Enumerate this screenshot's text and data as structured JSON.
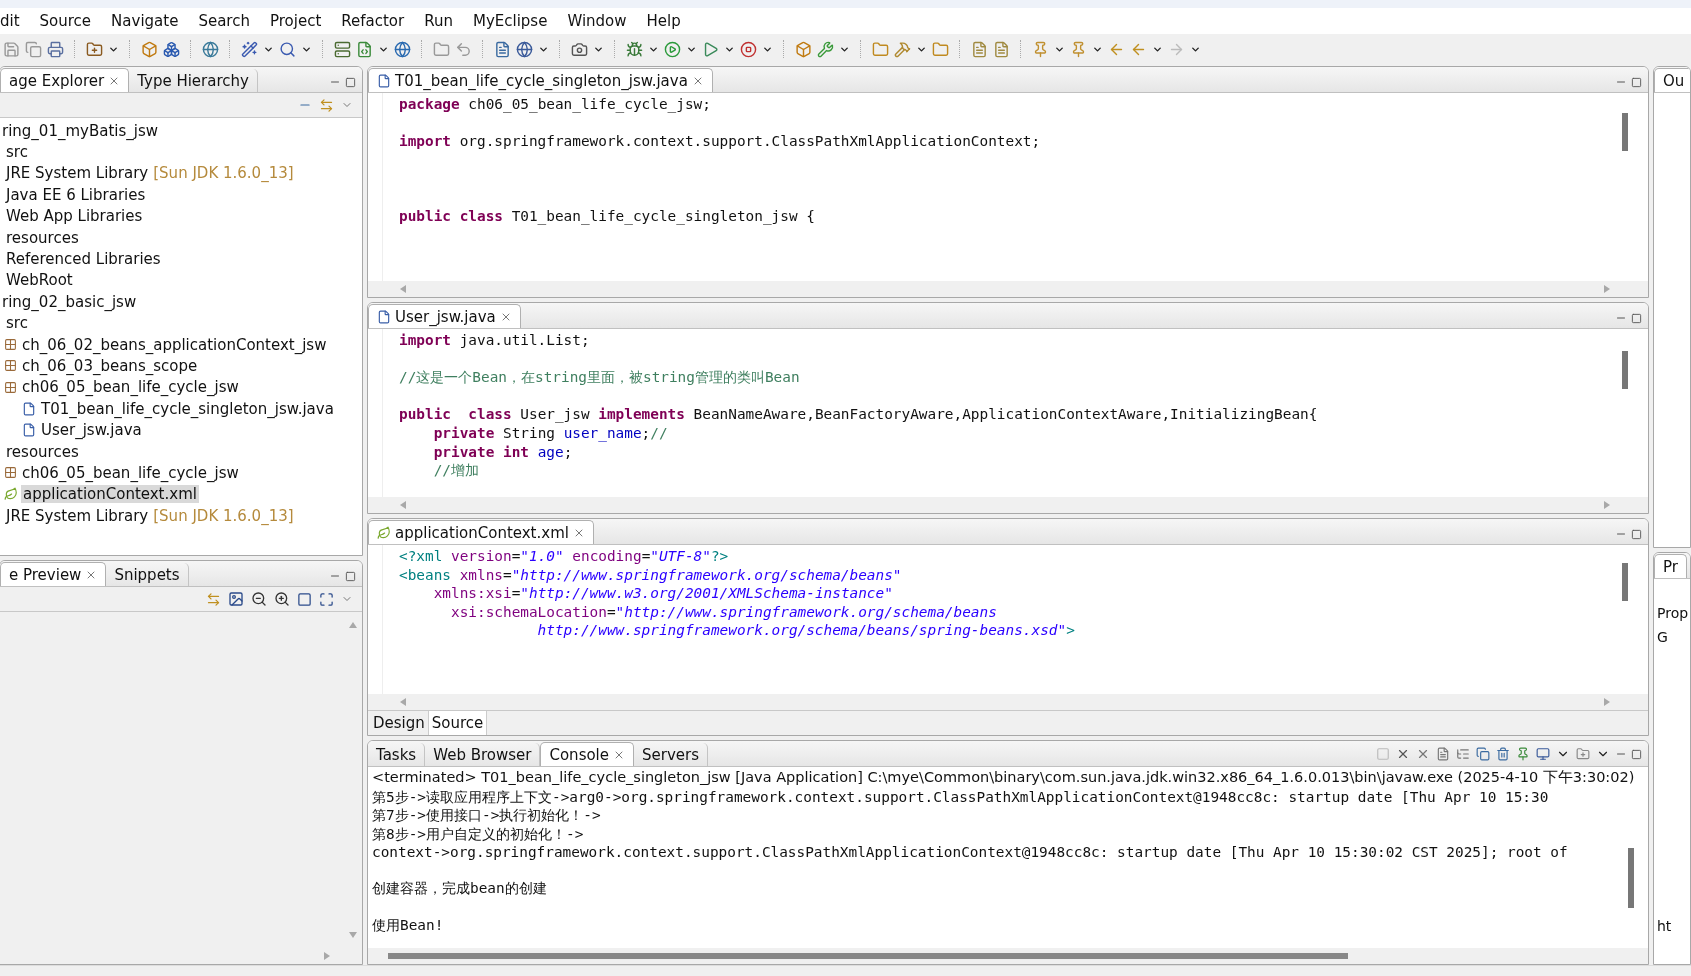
{
  "menu_bar": [
    "dit",
    "Source",
    "Navigate",
    "Search",
    "Project",
    "Refactor",
    "Run",
    "MyEclipse",
    "Window",
    "Help"
  ],
  "package_explorer": {
    "tabs": [
      {
        "label": "age Explorer",
        "selected": true
      },
      {
        "label": "Type Hierarchy",
        "selected": false
      }
    ],
    "tree": [
      {
        "label": "ring_01_myBatis_jsw",
        "selected": false,
        "children": [
          {
            "label": "src",
            "selected": false
          },
          {
            "label": "JRE System Library",
            "decoration": "[Sun JDK 1.6.0_13]",
            "selected": false
          },
          {
            "label": "Java EE 6 Libraries",
            "selected": false
          },
          {
            "label": "Web App Libraries",
            "selected": false
          },
          {
            "label": "resources",
            "selected": false
          },
          {
            "label": "Referenced Libraries",
            "selected": false
          },
          {
            "label": "WebRoot",
            "selected": false
          }
        ]
      },
      {
        "label": "ring_02_basic_jsw",
        "selected": false,
        "children": [
          {
            "label": "src",
            "selected": false,
            "children": [
              {
                "label": "ch_06_02_beans_applicationContext_jsw",
                "kind": "package",
                "selected": false
              },
              {
                "label": "ch_06_03_beans_scope",
                "kind": "package",
                "selected": false
              },
              {
                "label": "ch06_05_bean_life_cycle_jsw",
                "kind": "package",
                "selected": false,
                "children": [
                  {
                    "label": "T01_bean_life_cycle_singleton_jsw.java",
                    "kind": "java",
                    "selected": false
                  },
                  {
                    "label": "User_jsw.java",
                    "kind": "java",
                    "selected": false
                  }
                ]
              }
            ]
          },
          {
            "label": "resources",
            "selected": false,
            "children": [
              {
                "label": "ch06_05_bean_life_cycle_jsw",
                "kind": "package",
                "selected": false
              },
              {
                "label": "applicationContext.xml",
                "kind": "xml",
                "selected": true
              }
            ]
          },
          {
            "label": "JRE System Library",
            "decoration": "[Sun JDK 1.6.0_13]",
            "selected": false
          }
        ]
      }
    ]
  },
  "preview_panel": {
    "tabs": [
      {
        "label": "e Preview",
        "selected": true
      },
      {
        "label": "Snippets",
        "selected": false
      }
    ]
  },
  "editors": [
    {
      "tab": {
        "label": "T01_bean_life_cycle_singleton_jsw.java",
        "kind": "java",
        "selected": true
      },
      "lines": [
        {
          "kind": "code",
          "segments": [
            {
              "kind": "keyword",
              "text": "package"
            },
            {
              "kind": "plain",
              "text": " ch06_05_bean_life_cycle_jsw;"
            }
          ]
        },
        {
          "kind": "blank"
        },
        {
          "kind": "code",
          "segments": [
            {
              "kind": "keyword",
              "text": "import"
            },
            {
              "kind": "plain",
              "text": " org.springframework.context.support.ClassPathXmlApplicationContext;"
            }
          ]
        },
        {
          "kind": "blank"
        },
        {
          "kind": "blank"
        },
        {
          "kind": "blank"
        },
        {
          "kind": "code",
          "segments": [
            {
              "kind": "keyword",
              "text": "public class"
            },
            {
              "kind": "plain",
              "text": " T01_bean_life_cycle_singleton_jsw {"
            }
          ]
        }
      ]
    },
    {
      "tab": {
        "label": "User_jsw.java",
        "kind": "java",
        "selected": true
      },
      "lines": [
        {
          "kind": "code",
          "segments": [
            {
              "kind": "keyword",
              "text": "import"
            },
            {
              "kind": "plain",
              "text": " java.util.List;"
            }
          ]
        },
        {
          "kind": "blank"
        },
        {
          "kind": "code",
          "segments": [
            {
              "kind": "comment",
              "text": "//这是一个Bean，在string里面，被string管理的类叫Bean"
            }
          ]
        },
        {
          "kind": "blank"
        },
        {
          "kind": "code",
          "segments": [
            {
              "kind": "keyword",
              "text": "public  class"
            },
            {
              "kind": "plain",
              "text": " User_jsw "
            },
            {
              "kind": "keyword",
              "text": "implements"
            },
            {
              "kind": "plain",
              "text": " BeanNameAware,BeanFactoryAware,ApplicationContextAware,InitializingBean{"
            }
          ]
        },
        {
          "kind": "code",
          "segments": [
            {
              "kind": "keyword",
              "text": "    private"
            },
            {
              "kind": "plain",
              "text": " String "
            },
            {
              "kind": "field",
              "text": "user_name"
            },
            {
              "kind": "plain",
              "text": ";"
            },
            {
              "kind": "comment",
              "text": "//"
            }
          ]
        },
        {
          "kind": "code",
          "segments": [
            {
              "kind": "keyword",
              "text": "    private int"
            },
            {
              "kind": "field",
              "text": " age"
            },
            {
              "kind": "plain",
              "text": ";"
            }
          ]
        },
        {
          "kind": "code",
          "segments": [
            {
              "kind": "comment",
              "text": "    //增加"
            }
          ]
        }
      ]
    },
    {
      "tab": {
        "label": "applicationContext.xml",
        "kind": "xml",
        "selected": true
      },
      "lines": [
        {
          "kind": "code",
          "segments": [
            {
              "kind": "tag",
              "text": "<?xml"
            },
            {
              "kind": "attr",
              "text": " version"
            },
            {
              "kind": "plain",
              "text": "="
            },
            {
              "kind": "value",
              "text": "\"1.0\""
            },
            {
              "kind": "attr",
              "text": " encoding"
            },
            {
              "kind": "plain",
              "text": "="
            },
            {
              "kind": "value",
              "text": "\"UTF-8\""
            },
            {
              "kind": "tag",
              "text": "?>"
            }
          ]
        },
        {
          "kind": "code",
          "segments": [
            {
              "kind": "tag",
              "text": "<beans"
            },
            {
              "kind": "attr",
              "text": " xmlns"
            },
            {
              "kind": "plain",
              "text": "="
            },
            {
              "kind": "value",
              "text": "\"http://www.springframework.org/schema/beans\""
            }
          ]
        },
        {
          "kind": "code",
          "segments": [
            {
              "kind": "attr",
              "text": "    xmlns:xsi"
            },
            {
              "kind": "plain",
              "text": "="
            },
            {
              "kind": "value",
              "text": "\"http://www.w3.org/2001/XMLSchema-instance\""
            }
          ]
        },
        {
          "kind": "code",
          "segments": [
            {
              "kind": "attr",
              "text": "      xsi:schemaLocation"
            },
            {
              "kind": "plain",
              "text": "="
            },
            {
              "kind": "value",
              "text": "\"http://www.springframework.org/schema/beans"
            }
          ]
        },
        {
          "kind": "code",
          "segments": [
            {
              "kind": "value",
              "text": "                http://www.springframework.org/schema/beans/spring-beans.xsd\""
            },
            {
              "kind": "tag",
              "text": ">"
            }
          ]
        }
      ],
      "bottom_tabs": [
        {
          "label": "Design",
          "selected": false
        },
        {
          "label": "Source",
          "selected": true
        }
      ]
    }
  ],
  "console": {
    "tabs": [
      {
        "label": "Tasks",
        "selected": false
      },
      {
        "label": "Web Browser",
        "selected": false
      },
      {
        "label": "Console",
        "selected": true
      },
      {
        "label": "Servers",
        "selected": false
      }
    ],
    "header": "<terminated> T01_bean_life_cycle_singleton_jsw [Java Application] C:\\mye\\Common\\binary\\com.sun.java.jdk.win32.x86_64_1.6.0.013\\bin\\javaw.exe (2025-4-10 下午3:30:02)",
    "lines": [
      {
        "kind": "text",
        "text": "第5步->读取应用程序上下文->arg0->org.springframework.context.support.ClassPathXmlApplicationContext@1948cc8c: startup date [Thu Apr 10 15:30"
      },
      {
        "kind": "text",
        "text": "第7步->使用接口->执行初始化！->"
      },
      {
        "kind": "text",
        "text": "第8步->用户自定义的初始化！->"
      },
      {
        "kind": "text",
        "text": "context->org.springframework.context.support.ClassPathXmlApplicationContext@1948cc8c: startup date [Thu Apr 10 15:30:02 CST 2025]; root of"
      },
      {
        "kind": "blank"
      },
      {
        "kind": "text",
        "text": "创建容器，完成bean的创建"
      },
      {
        "kind": "blank"
      },
      {
        "kind": "text",
        "text": "使用Bean!"
      }
    ]
  },
  "right_column": {
    "top_tab": "Ou",
    "bottom_tab": "Pr",
    "texts": [
      "Prop",
      "G"
    ],
    "footer_text": "ht"
  }
}
